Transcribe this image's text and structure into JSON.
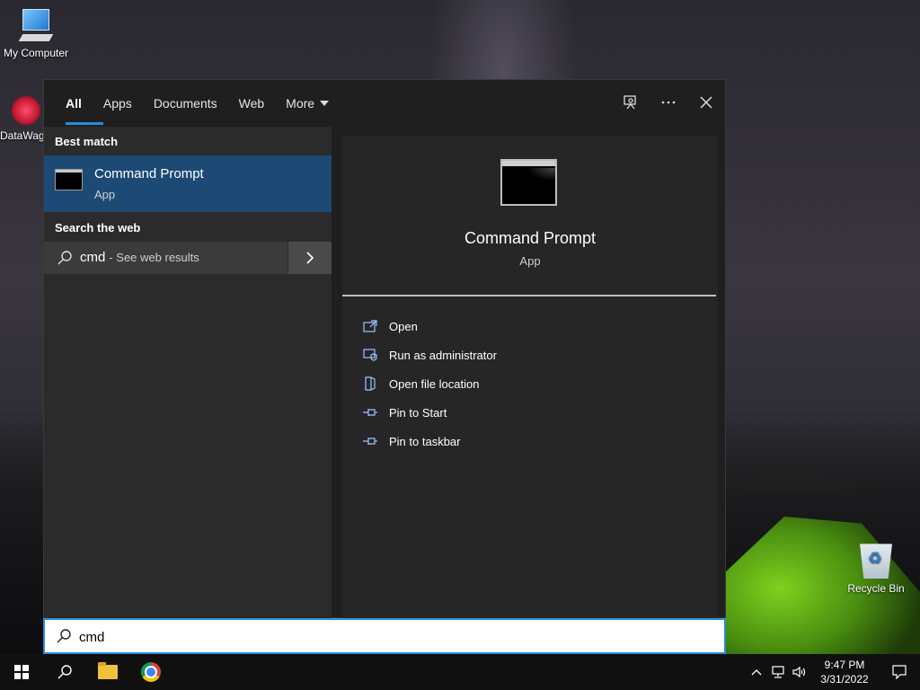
{
  "desktop": {
    "icons": [
      {
        "label": "My Computer"
      },
      {
        "label": "DataWag"
      },
      {
        "label": "Recycle Bin"
      }
    ]
  },
  "search_panel": {
    "tabs": [
      {
        "label": "All",
        "active": true
      },
      {
        "label": "Apps"
      },
      {
        "label": "Documents"
      },
      {
        "label": "Web"
      },
      {
        "label": "More"
      }
    ],
    "top_icons": [
      "feedback-icon",
      "more-options-icon",
      "close-icon"
    ],
    "best_match": {
      "section_label": "Best match",
      "title": "Command Prompt",
      "subtitle": "App"
    },
    "search_web": {
      "section_label": "Search the web",
      "query": "cmd",
      "suffix": "- See web results"
    },
    "detail": {
      "title": "Command Prompt",
      "subtitle": "App",
      "actions": [
        {
          "label": "Open",
          "icon": "open-icon"
        },
        {
          "label": "Run as administrator",
          "icon": "shield-icon"
        },
        {
          "label": "Open file location",
          "icon": "file-location-icon"
        },
        {
          "label": "Pin to Start",
          "icon": "pin-icon"
        },
        {
          "label": "Pin to taskbar",
          "icon": "pin-icon"
        }
      ]
    },
    "search_box": {
      "value": "cmd"
    }
  },
  "taskbar": {
    "clock": {
      "time": "9:47 PM",
      "date": "3/31/2022"
    }
  },
  "colors": {
    "accent": "#2b8cd9",
    "selection": "#1c4a75",
    "panel": "#1f1f1f"
  }
}
